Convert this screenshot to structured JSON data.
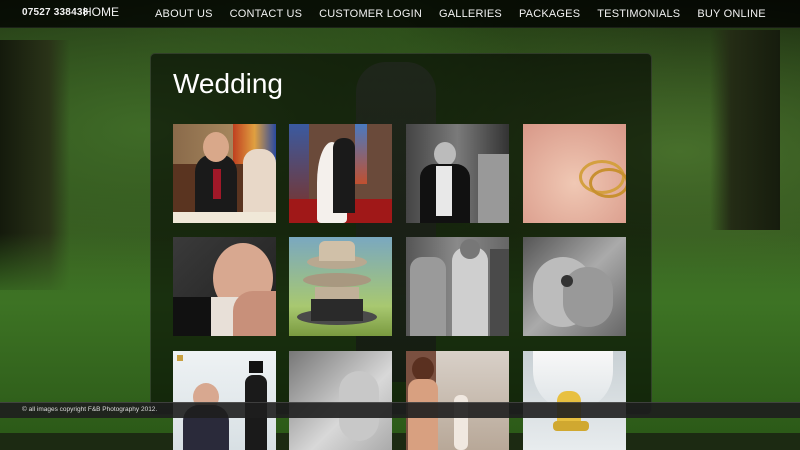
{
  "header": {
    "phone": "07527 338438",
    "home_label": "HOME",
    "nav": [
      {
        "label": "ABOUT US"
      },
      {
        "label": "CONTACT US"
      },
      {
        "label": "CUSTOMER LOGIN"
      },
      {
        "label": "GALLERIES"
      },
      {
        "label": "PACKAGES"
      },
      {
        "label": "TESTIMONIALS"
      },
      {
        "label": "BUY ONLINE"
      }
    ]
  },
  "main": {
    "title": "Wedding"
  },
  "footer": {
    "copyright": "© all images copyright F&B Photography 2012."
  },
  "colors": {
    "nav_bg": "#000000",
    "text": "#f2f2f2",
    "panel_bg": "#000000",
    "grass": "#3d7324"
  }
}
